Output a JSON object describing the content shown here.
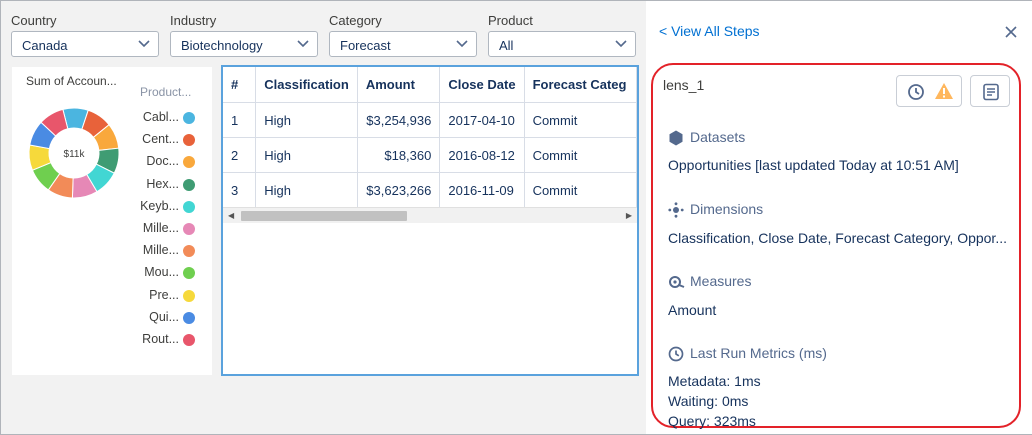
{
  "filters": [
    {
      "label": "Country",
      "value": "Canada"
    },
    {
      "label": "Industry",
      "value": "Biotechnology"
    },
    {
      "label": "Category",
      "value": "Forecast"
    },
    {
      "label": "Product",
      "value": "All"
    }
  ],
  "chart": {
    "title": "Sum of Accoun...",
    "center_label": "$11k",
    "legend_title": "Product...",
    "legend": [
      {
        "name": "Cabl...",
        "color": "#4bb5e0"
      },
      {
        "name": "Cent...",
        "color": "#e8623a"
      },
      {
        "name": "Doc...",
        "color": "#f9a83c"
      },
      {
        "name": "Hex...",
        "color": "#3f9c73"
      },
      {
        "name": "Keyb...",
        "color": "#42d6d3"
      },
      {
        "name": "Mille...",
        "color": "#e688b6"
      },
      {
        "name": "Mille...",
        "color": "#f28b58"
      },
      {
        "name": "Mou...",
        "color": "#6fcf4f"
      },
      {
        "name": "Pre...",
        "color": "#f6d93b"
      },
      {
        "name": "Qui...",
        "color": "#4a8be3"
      },
      {
        "name": "Rout...",
        "color": "#e8566b"
      }
    ]
  },
  "table": {
    "columns": [
      "#",
      "Classification",
      "Amount",
      "Close Date",
      "Forecast Categ"
    ],
    "rows": [
      [
        "1",
        "High",
        "$3,254,936",
        "2017-04-10",
        "Commit"
      ],
      [
        "2",
        "High",
        "$18,360",
        "2016-08-12",
        "Commit"
      ],
      [
        "3",
        "High",
        "$3,623,266",
        "2016-11-09",
        "Commit"
      ]
    ]
  },
  "panel": {
    "back_link": "< View All Steps",
    "step_name": "lens_1",
    "datasets_label": "Datasets",
    "datasets_value": "Opportunities [last updated Today at 10:51 AM]",
    "dimensions_label": "Dimensions",
    "dimensions_value": "Classification, Close Date, Forecast Category, Oppor...",
    "measures_label": "Measures",
    "measures_value": "Amount",
    "metrics_label": "Last Run Metrics (ms)",
    "metrics": [
      "Metadata: 1ms",
      "Waiting: 0ms",
      "Query: 323ms"
    ]
  },
  "icons": {
    "filter_chevron": "chevron-down-icon",
    "close": "close-icon",
    "history": "clock-icon",
    "warning": "warning-icon",
    "details": "document-icon",
    "datasets": "hexagon-icon",
    "dimensions": "dimensions-icon",
    "measures": "measure-icon",
    "metrics": "clock-icon"
  },
  "colors": {
    "accent": "#0070d2",
    "highlight": "#e32229",
    "table_border": "#5aa2dd",
    "warning": "#ffb75d"
  }
}
